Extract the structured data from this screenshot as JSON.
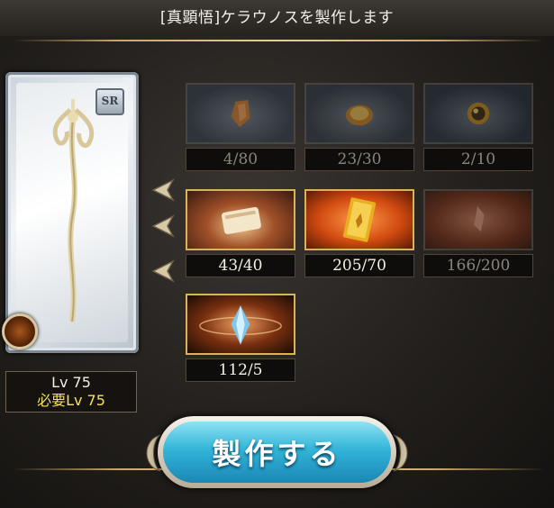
{
  "header": {
    "title": "[真顕悟]ケラウノスを製作します"
  },
  "weapon": {
    "rarity": "SR",
    "level_text": "Lv 75",
    "required_level_text": "必要Lv 75",
    "icon": "staff-weapon-icon",
    "element_icon": "fire-element-icon"
  },
  "materials": [
    {
      "count": "4/80",
      "icon": "orange-shard-icon",
      "satisfied": false
    },
    {
      "count": "23/30",
      "icon": "gold-coin-icon",
      "satisfied": false
    },
    {
      "count": "2/10",
      "icon": "dark-orb-icon",
      "satisfied": false
    },
    {
      "count": "43/40",
      "icon": "scroll-icon",
      "satisfied": true
    },
    {
      "count": "205/70",
      "icon": "golden-book-icon",
      "satisfied": true
    },
    {
      "count": "166/200",
      "icon": "red-shard-icon",
      "satisfied": false
    },
    {
      "count": "112/5",
      "icon": "blue-crystal-icon",
      "satisfied": true
    }
  ],
  "actions": {
    "craft_label": "製作する"
  },
  "colors": {
    "accent": "#33b5d9",
    "required_text": "#f5e25b",
    "frame_gold": "#c8a96a"
  }
}
